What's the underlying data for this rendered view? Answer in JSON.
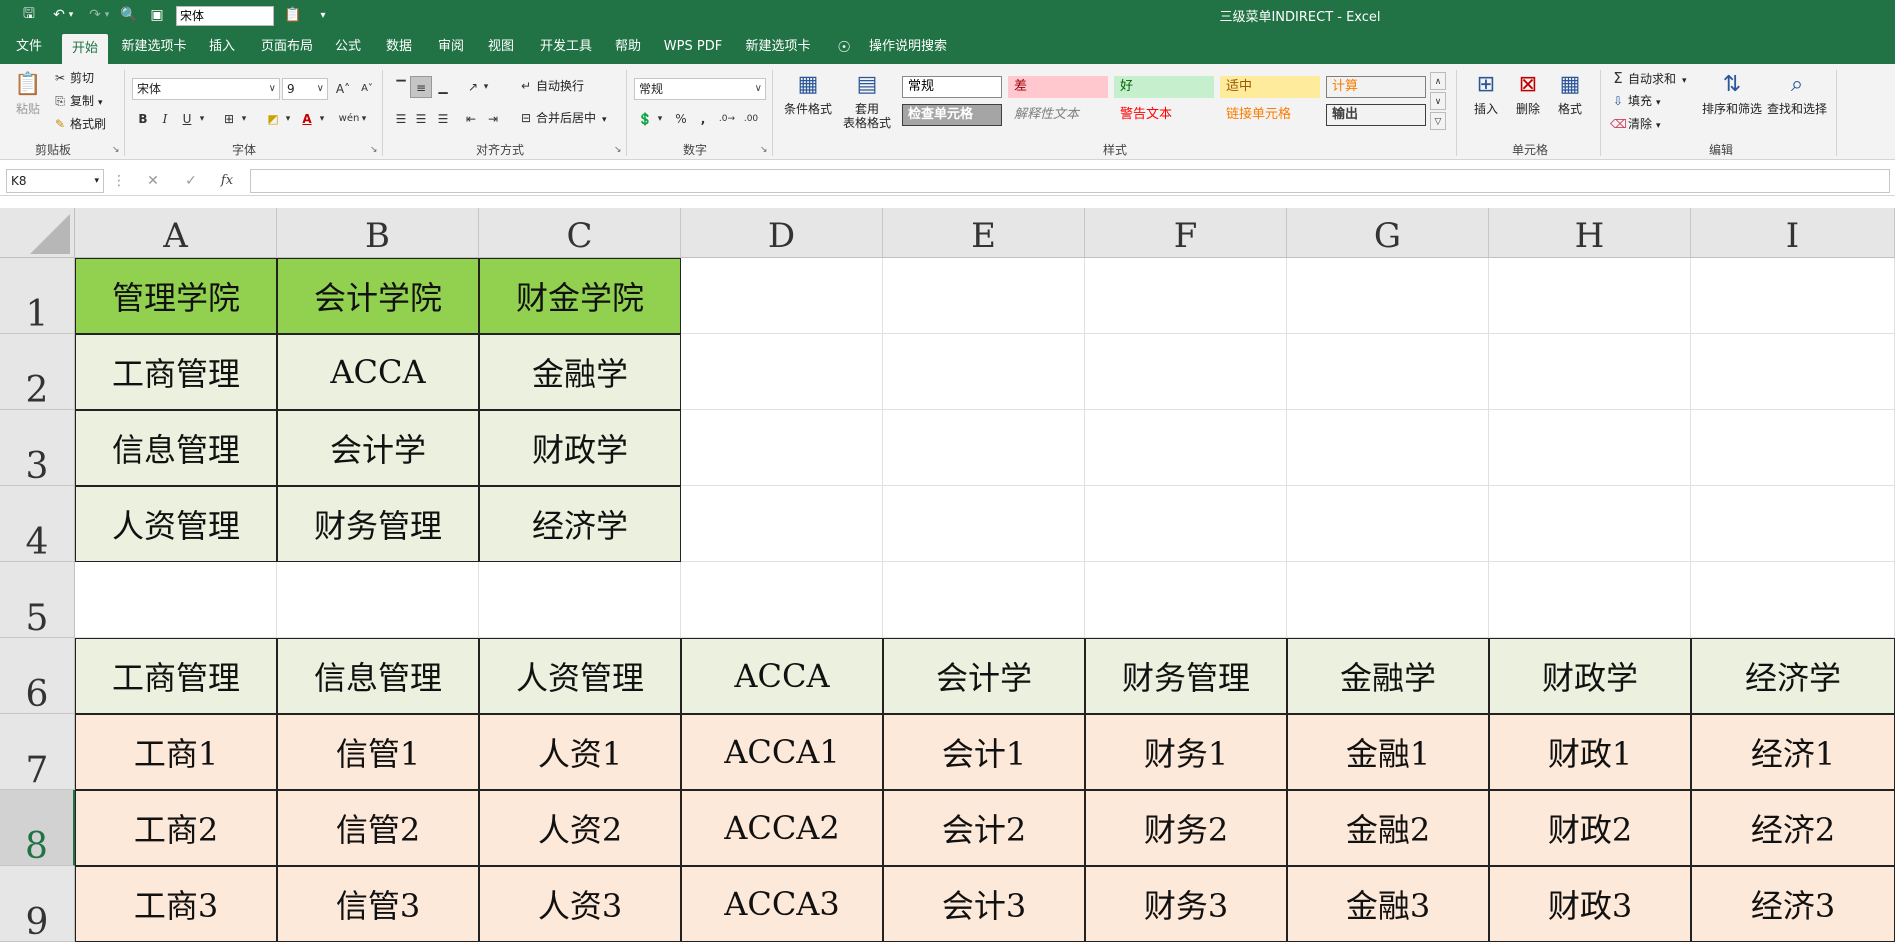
{
  "quick_access": {
    "font_box": "宋体"
  },
  "window": {
    "title": "三级菜单INDIRECT  -  Excel"
  },
  "menu": {
    "tabs": [
      "文件",
      "开始",
      "新建选项卡",
      "插入",
      "页面布局",
      "公式",
      "数据",
      "审阅",
      "视图",
      "开发工具",
      "帮助",
      "WPS PDF",
      "新建选项卡",
      "操作说明搜索"
    ],
    "active_index": 1
  },
  "ribbon": {
    "clipboard": {
      "label": "剪贴板",
      "paste": "粘贴",
      "cut": "剪切",
      "copy": "复制",
      "format_painter": "格式刷"
    },
    "font": {
      "label": "字体",
      "font_name": "宋体",
      "font_size": "9",
      "bold": "B",
      "italic": "I",
      "underline": "U"
    },
    "alignment": {
      "label": "对齐方式",
      "wrap": "自动换行",
      "merge": "合并后居中"
    },
    "number": {
      "label": "数字",
      "format": "常规",
      "percent": "%",
      "comma": ","
    },
    "styles": {
      "label": "样式",
      "conditional": "条件格式",
      "table_format_1": "套用",
      "table_format_2": "表格格式",
      "cells": [
        {
          "text": "常规",
          "bg": "#ffffff",
          "color": "#000000",
          "border": "#888888"
        },
        {
          "text": "差",
          "bg": "#ffc7ce",
          "color": "#9c0006",
          "border": "transparent"
        },
        {
          "text": "好",
          "bg": "#c6efce",
          "color": "#006100",
          "border": "transparent"
        },
        {
          "text": "适中",
          "bg": "#ffeb9c",
          "color": "#9c5700",
          "border": "transparent"
        },
        {
          "text": "计算",
          "bg": "#f2f2f2",
          "color": "#fa7d00",
          "border": "#7f7f7f"
        },
        {
          "text": "检查单元格",
          "bg": "#a5a5a5",
          "color": "#ffffff",
          "border": "#3f3f3f"
        },
        {
          "text": "解释性文本",
          "bg": "#f3f3f3",
          "color": "#7f7f7f",
          "border": "transparent"
        },
        {
          "text": "警告文本",
          "bg": "#f3f3f3",
          "color": "#ff0000",
          "border": "transparent"
        },
        {
          "text": "链接单元格",
          "bg": "#f3f3f3",
          "color": "#fa7d00",
          "border": "transparent"
        },
        {
          "text": "输出",
          "bg": "#f2f2f2",
          "color": "#3f3f3f",
          "border": "#3f3f3f"
        }
      ]
    },
    "cells": {
      "label": "单元格",
      "insert": "插入",
      "delete": "删除",
      "format": "格式"
    },
    "editing": {
      "label": "编辑",
      "autosum": "自动求和",
      "fill": "填充",
      "clear": "清除",
      "sort_filter": "排序和筛选",
      "find_select": "查找和选择"
    }
  },
  "formula_bar": {
    "name_box": "K8",
    "fx": "fx",
    "value": ""
  },
  "sheet": {
    "columns": [
      "A",
      "B",
      "C",
      "D",
      "E",
      "F",
      "G",
      "H",
      "I"
    ],
    "rows": [
      "1",
      "2",
      "3",
      "4",
      "5",
      "6",
      "7",
      "8",
      "9"
    ],
    "selected_row": "8",
    "table1": [
      [
        "管理学院",
        "会计学院",
        "财金学院"
      ],
      [
        "工商管理",
        "ACCA",
        "金融学"
      ],
      [
        "信息管理",
        "会计学",
        "财政学"
      ],
      [
        "人资管理",
        "财务管理",
        "经济学"
      ]
    ],
    "table2_header": [
      "工商管理",
      "信息管理",
      "人资管理",
      "ACCA",
      "会计学",
      "财务管理",
      "金融学",
      "财政学",
      "经济学"
    ],
    "table2_rows": [
      [
        "工商1",
        "信管1",
        "人资1",
        "ACCA1",
        "会计1",
        "财务1",
        "金融1",
        "财政1",
        "经济1"
      ],
      [
        "工商2",
        "信管2",
        "人资2",
        "ACCA2",
        "会计2",
        "财务2",
        "金融2",
        "财政2",
        "经济2"
      ],
      [
        "工商3",
        "信管3",
        "人资3",
        "ACCA3",
        "会计3",
        "财务3",
        "金融3",
        "财政3",
        "经济3"
      ]
    ]
  }
}
